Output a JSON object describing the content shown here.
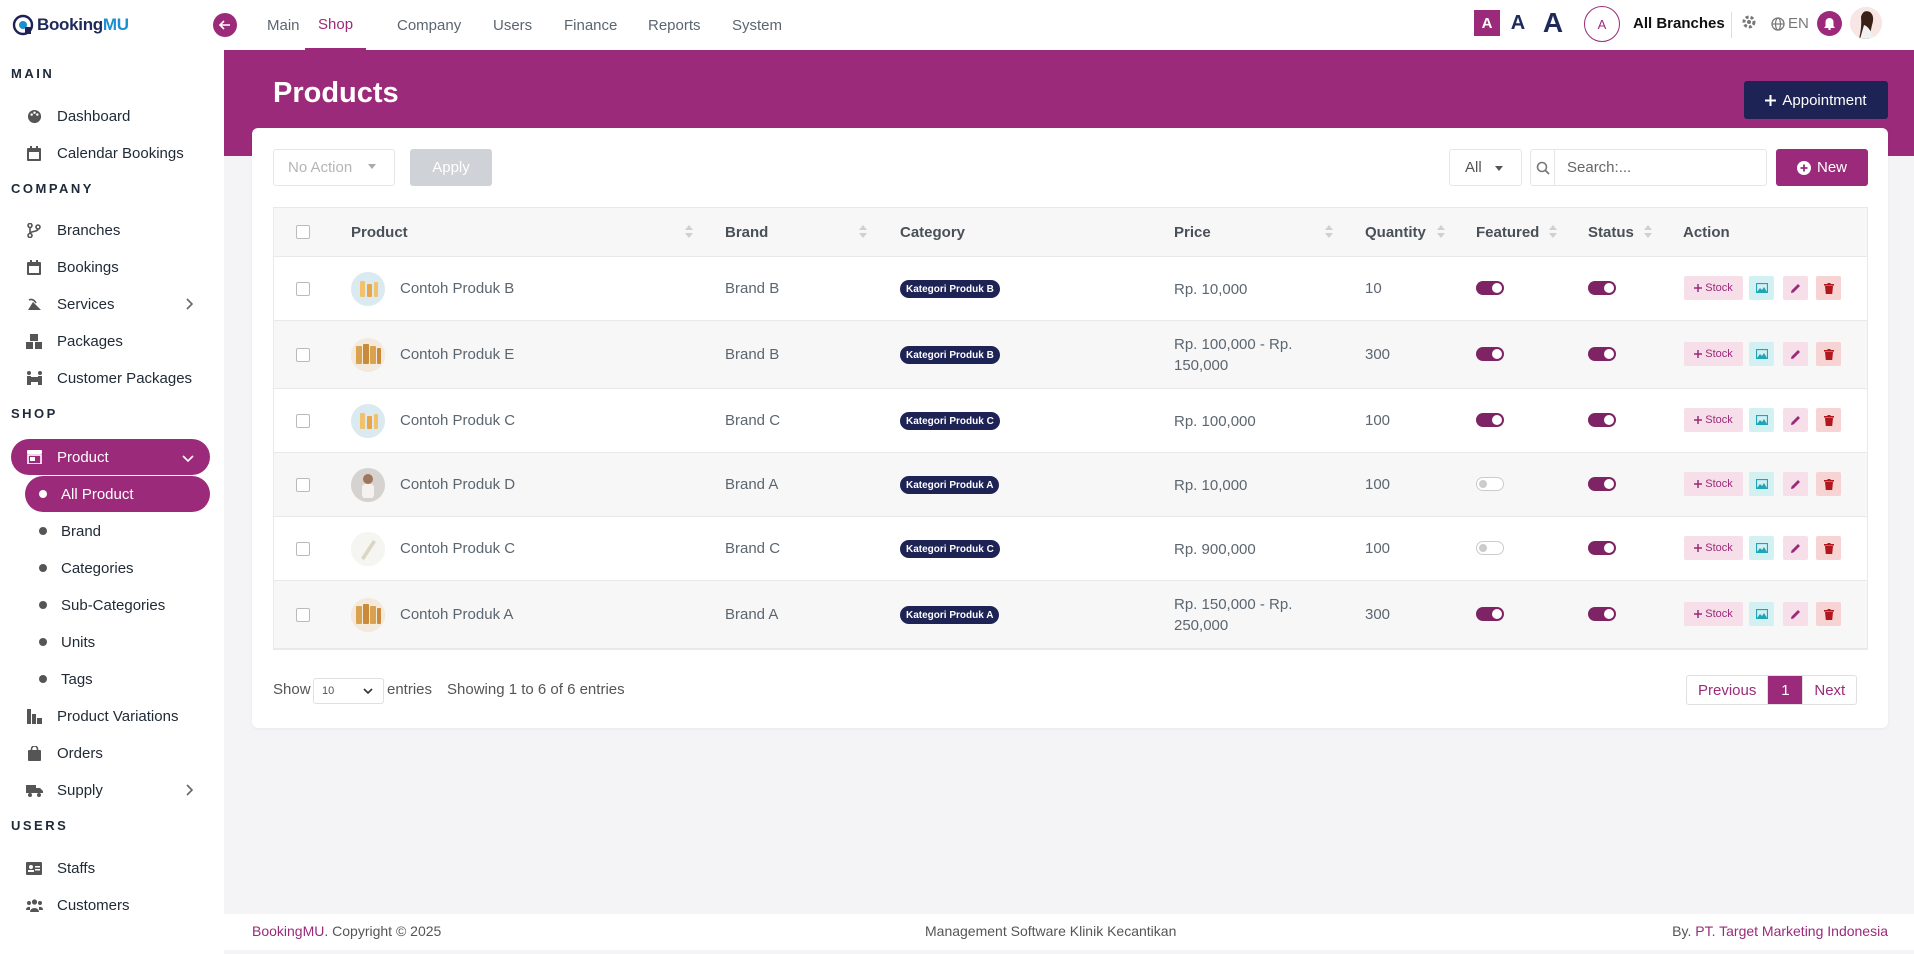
{
  "app": {
    "logo_text_a": "Booking",
    "logo_text_b": "MU"
  },
  "colors": {
    "accent": "#9b2a7a",
    "navy": "#1d2354",
    "toggle_on": "#7e2363"
  },
  "topnav": {
    "tabs": [
      "Main",
      "Shop",
      "Company",
      "Users",
      "Finance",
      "Reports",
      "System"
    ],
    "active": "Shop",
    "font_sizes": [
      "A",
      "A",
      "A"
    ],
    "branch_initial": "A",
    "branch_label": "All Branches",
    "lang": "EN"
  },
  "sidebar": {
    "sections": {
      "main": "MAIN",
      "company": "COMPANY",
      "shop": "SHOP",
      "users": "USERS"
    },
    "main_items": [
      {
        "label": "Dashboard",
        "icon": "palette-icon"
      },
      {
        "label": "Calendar Bookings",
        "icon": "calendar-icon"
      }
    ],
    "company_items": [
      {
        "label": "Branches",
        "icon": "branch-icon"
      },
      {
        "label": "Bookings",
        "icon": "calendar-icon"
      },
      {
        "label": "Services",
        "icon": "services-icon"
      },
      {
        "label": "Packages",
        "icon": "cubes-icon"
      },
      {
        "label": "Customer Packages",
        "icon": "people-carry-icon"
      }
    ],
    "shop_items": [
      {
        "label": "Product",
        "icon": "store-icon"
      },
      {
        "label": "Product Variations",
        "icon": "variations-icon"
      },
      {
        "label": "Orders",
        "icon": "bag-icon"
      },
      {
        "label": "Supply",
        "icon": "truck-icon"
      }
    ],
    "product_sub": [
      "All Product",
      "Brand",
      "Categories",
      "Sub-Categories",
      "Units",
      "Tags"
    ],
    "users_items": [
      {
        "label": "Staffs",
        "icon": "id-card-icon"
      },
      {
        "label": "Customers",
        "icon": "users-icon"
      }
    ]
  },
  "page": {
    "title": "Products",
    "appointment_label": "Appointment"
  },
  "toolbar": {
    "bulk_action": "No Action",
    "apply_label": "Apply",
    "filter_value": "All",
    "search_placeholder": "Search:...",
    "new_label": "New"
  },
  "table": {
    "headers": [
      "Product",
      "Brand",
      "Category",
      "Price",
      "Quantity",
      "Featured",
      "Status",
      "Action"
    ],
    "stock_label": "Stock",
    "rows": [
      {
        "product": "Contoh Produk B",
        "brand": "Brand B",
        "category": "Kategori Produk B",
        "price": "Rp. 10,000",
        "quantity": "10",
        "featured": true,
        "status": true
      },
      {
        "product": "Contoh Produk E",
        "brand": "Brand B",
        "category": "Kategori Produk B",
        "price": "Rp. 100,000 - Rp. 150,000",
        "quantity": "300",
        "featured": true,
        "status": true
      },
      {
        "product": "Contoh Produk C",
        "brand": "Brand C",
        "category": "Kategori Produk C",
        "price": "Rp. 100,000",
        "quantity": "100",
        "featured": true,
        "status": true
      },
      {
        "product": "Contoh Produk D",
        "brand": "Brand A",
        "category": "Kategori Produk A",
        "price": "Rp. 10,000",
        "quantity": "100",
        "featured": false,
        "status": true
      },
      {
        "product": "Contoh Produk C",
        "brand": "Brand C",
        "category": "Kategori Produk C",
        "price": "Rp. 900,000",
        "quantity": "100",
        "featured": false,
        "status": true
      },
      {
        "product": "Contoh Produk A",
        "brand": "Brand A",
        "category": "Kategori Produk A",
        "price": "Rp. 150,000 - Rp. 250,000",
        "quantity": "300",
        "featured": true,
        "status": true
      }
    ]
  },
  "pagination": {
    "show_label": "Show",
    "entries_value": "10",
    "entries_label": "entries",
    "info": "Showing 1 to 6 of 6 entries",
    "previous": "Previous",
    "current": "1",
    "next": "Next"
  },
  "footer": {
    "left_brand": "BookingMU",
    "left_rest": ". Copyright © 2025",
    "center": "Management Software Klinik Kecantikan",
    "right_prefix": "By. ",
    "right_brand": "PT. Target Marketing Indonesia"
  }
}
